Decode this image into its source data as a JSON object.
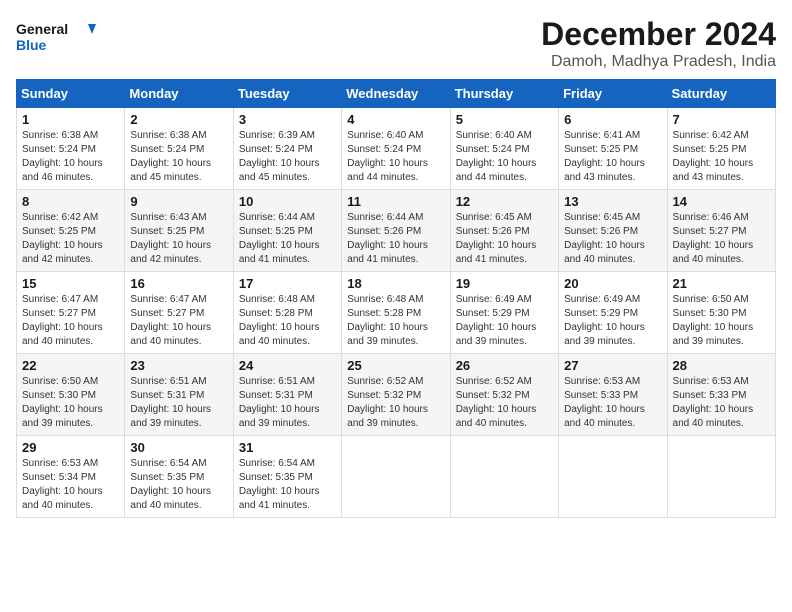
{
  "header": {
    "logo_general": "General",
    "logo_blue": "Blue",
    "title": "December 2024",
    "subtitle": "Damoh, Madhya Pradesh, India"
  },
  "calendar": {
    "days_of_week": [
      "Sunday",
      "Monday",
      "Tuesday",
      "Wednesday",
      "Thursday",
      "Friday",
      "Saturday"
    ],
    "weeks": [
      [
        null,
        {
          "day": "2",
          "sunrise": "Sunrise: 6:38 AM",
          "sunset": "Sunset: 5:24 PM",
          "daylight": "Daylight: 10 hours and 45 minutes."
        },
        {
          "day": "3",
          "sunrise": "Sunrise: 6:39 AM",
          "sunset": "Sunset: 5:24 PM",
          "daylight": "Daylight: 10 hours and 45 minutes."
        },
        {
          "day": "4",
          "sunrise": "Sunrise: 6:40 AM",
          "sunset": "Sunset: 5:24 PM",
          "daylight": "Daylight: 10 hours and 44 minutes."
        },
        {
          "day": "5",
          "sunrise": "Sunrise: 6:40 AM",
          "sunset": "Sunset: 5:24 PM",
          "daylight": "Daylight: 10 hours and 44 minutes."
        },
        {
          "day": "6",
          "sunrise": "Sunrise: 6:41 AM",
          "sunset": "Sunset: 5:25 PM",
          "daylight": "Daylight: 10 hours and 43 minutes."
        },
        {
          "day": "7",
          "sunrise": "Sunrise: 6:42 AM",
          "sunset": "Sunset: 5:25 PM",
          "daylight": "Daylight: 10 hours and 43 minutes."
        }
      ],
      [
        {
          "day": "1",
          "sunrise": "Sunrise: 6:38 AM",
          "sunset": "Sunset: 5:24 PM",
          "daylight": "Daylight: 10 hours and 46 minutes."
        },
        {
          "day": "9",
          "sunrise": "Sunrise: 6:43 AM",
          "sunset": "Sunset: 5:25 PM",
          "daylight": "Daylight: 10 hours and 42 minutes."
        },
        {
          "day": "10",
          "sunrise": "Sunrise: 6:44 AM",
          "sunset": "Sunset: 5:25 PM",
          "daylight": "Daylight: 10 hours and 41 minutes."
        },
        {
          "day": "11",
          "sunrise": "Sunrise: 6:44 AM",
          "sunset": "Sunset: 5:26 PM",
          "daylight": "Daylight: 10 hours and 41 minutes."
        },
        {
          "day": "12",
          "sunrise": "Sunrise: 6:45 AM",
          "sunset": "Sunset: 5:26 PM",
          "daylight": "Daylight: 10 hours and 41 minutes."
        },
        {
          "day": "13",
          "sunrise": "Sunrise: 6:45 AM",
          "sunset": "Sunset: 5:26 PM",
          "daylight": "Daylight: 10 hours and 40 minutes."
        },
        {
          "day": "14",
          "sunrise": "Sunrise: 6:46 AM",
          "sunset": "Sunset: 5:27 PM",
          "daylight": "Daylight: 10 hours and 40 minutes."
        }
      ],
      [
        {
          "day": "8",
          "sunrise": "Sunrise: 6:42 AM",
          "sunset": "Sunset: 5:25 PM",
          "daylight": "Daylight: 10 hours and 42 minutes."
        },
        {
          "day": "16",
          "sunrise": "Sunrise: 6:47 AM",
          "sunset": "Sunset: 5:27 PM",
          "daylight": "Daylight: 10 hours and 40 minutes."
        },
        {
          "day": "17",
          "sunrise": "Sunrise: 6:48 AM",
          "sunset": "Sunset: 5:28 PM",
          "daylight": "Daylight: 10 hours and 40 minutes."
        },
        {
          "day": "18",
          "sunrise": "Sunrise: 6:48 AM",
          "sunset": "Sunset: 5:28 PM",
          "daylight": "Daylight: 10 hours and 39 minutes."
        },
        {
          "day": "19",
          "sunrise": "Sunrise: 6:49 AM",
          "sunset": "Sunset: 5:29 PM",
          "daylight": "Daylight: 10 hours and 39 minutes."
        },
        {
          "day": "20",
          "sunrise": "Sunrise: 6:49 AM",
          "sunset": "Sunset: 5:29 PM",
          "daylight": "Daylight: 10 hours and 39 minutes."
        },
        {
          "day": "21",
          "sunrise": "Sunrise: 6:50 AM",
          "sunset": "Sunset: 5:30 PM",
          "daylight": "Daylight: 10 hours and 39 minutes."
        }
      ],
      [
        {
          "day": "15",
          "sunrise": "Sunrise: 6:47 AM",
          "sunset": "Sunset: 5:27 PM",
          "daylight": "Daylight: 10 hours and 40 minutes."
        },
        {
          "day": "23",
          "sunrise": "Sunrise: 6:51 AM",
          "sunset": "Sunset: 5:31 PM",
          "daylight": "Daylight: 10 hours and 39 minutes."
        },
        {
          "day": "24",
          "sunrise": "Sunrise: 6:51 AM",
          "sunset": "Sunset: 5:31 PM",
          "daylight": "Daylight: 10 hours and 39 minutes."
        },
        {
          "day": "25",
          "sunrise": "Sunrise: 6:52 AM",
          "sunset": "Sunset: 5:32 PM",
          "daylight": "Daylight: 10 hours and 39 minutes."
        },
        {
          "day": "26",
          "sunrise": "Sunrise: 6:52 AM",
          "sunset": "Sunset: 5:32 PM",
          "daylight": "Daylight: 10 hours and 40 minutes."
        },
        {
          "day": "27",
          "sunrise": "Sunrise: 6:53 AM",
          "sunset": "Sunset: 5:33 PM",
          "daylight": "Daylight: 10 hours and 40 minutes."
        },
        {
          "day": "28",
          "sunrise": "Sunrise: 6:53 AM",
          "sunset": "Sunset: 5:33 PM",
          "daylight": "Daylight: 10 hours and 40 minutes."
        }
      ],
      [
        {
          "day": "22",
          "sunrise": "Sunrise: 6:50 AM",
          "sunset": "Sunset: 5:30 PM",
          "daylight": "Daylight: 10 hours and 39 minutes."
        },
        {
          "day": "30",
          "sunrise": "Sunrise: 6:54 AM",
          "sunset": "Sunset: 5:35 PM",
          "daylight": "Daylight: 10 hours and 40 minutes."
        },
        {
          "day": "31",
          "sunrise": "Sunrise: 6:54 AM",
          "sunset": "Sunset: 5:35 PM",
          "daylight": "Daylight: 10 hours and 41 minutes."
        },
        null,
        null,
        null,
        null
      ],
      [
        {
          "day": "29",
          "sunrise": "Sunrise: 6:53 AM",
          "sunset": "Sunset: 5:34 PM",
          "daylight": "Daylight: 10 hours and 40 minutes."
        }
      ]
    ],
    "row_data": [
      {
        "cells": [
          {
            "day": null
          },
          {
            "day": "2",
            "sunrise": "Sunrise: 6:38 AM",
            "sunset": "Sunset: 5:24 PM",
            "daylight": "Daylight: 10 hours and 45 minutes."
          },
          {
            "day": "3",
            "sunrise": "Sunrise: 6:39 AM",
            "sunset": "Sunset: 5:24 PM",
            "daylight": "Daylight: 10 hours and 45 minutes."
          },
          {
            "day": "4",
            "sunrise": "Sunrise: 6:40 AM",
            "sunset": "Sunset: 5:24 PM",
            "daylight": "Daylight: 10 hours and 44 minutes."
          },
          {
            "day": "5",
            "sunrise": "Sunrise: 6:40 AM",
            "sunset": "Sunset: 5:24 PM",
            "daylight": "Daylight: 10 hours and 44 minutes."
          },
          {
            "day": "6",
            "sunrise": "Sunrise: 6:41 AM",
            "sunset": "Sunset: 5:25 PM",
            "daylight": "Daylight: 10 hours and 43 minutes."
          },
          {
            "day": "7",
            "sunrise": "Sunrise: 6:42 AM",
            "sunset": "Sunset: 5:25 PM",
            "daylight": "Daylight: 10 hours and 43 minutes."
          }
        ]
      }
    ]
  }
}
